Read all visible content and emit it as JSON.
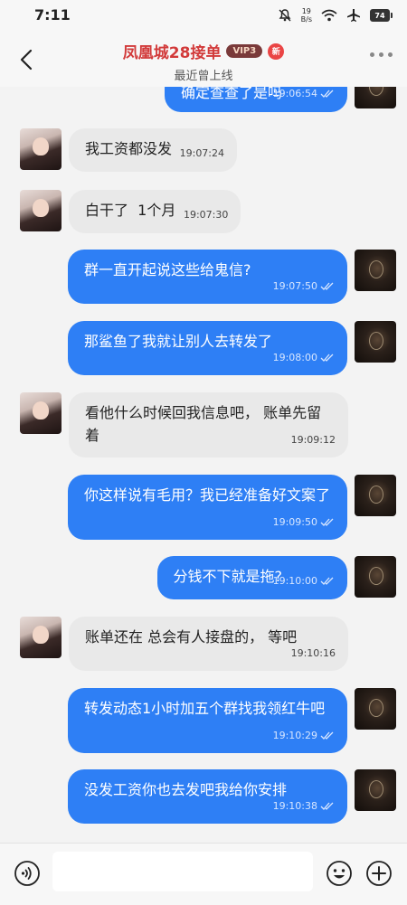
{
  "status_bar": {
    "time": "7:11",
    "net_speed_value": "19",
    "net_speed_unit": "B/s",
    "battery": "74"
  },
  "header": {
    "title": "凤凰城28接单",
    "vip_badge": "VIP3",
    "new_badge": "新",
    "subtitle": "最近曾上线"
  },
  "messages": [
    {
      "side": "out",
      "text": "确定查查了是吗",
      "time": "19:06:54"
    },
    {
      "side": "in",
      "text": "我工资都没发",
      "time": "19:07:24"
    },
    {
      "side": "in",
      "text": "白干了  1个月",
      "time": "19:07:30"
    },
    {
      "side": "out",
      "text": "群一直开起说这些给鬼信?",
      "time": "19:07:50"
    },
    {
      "side": "out",
      "text": "那鲨鱼了我就让别人去转发了",
      "time": "19:08:00"
    },
    {
      "side": "in",
      "text": "看他什么时候回我信息吧，  账单先留着",
      "time": "19:09:12"
    },
    {
      "side": "out",
      "text": "你这样说有毛用？我已经准备好文案了",
      "time": "19:09:50"
    },
    {
      "side": "out",
      "text": "分钱不下就是拖?",
      "time": "19:10:00"
    },
    {
      "side": "in",
      "text": "账单还在 总会有人接盘的，  等吧",
      "time": "19:10:16"
    },
    {
      "side": "out",
      "text": "转发动态1小时加五个群找我领红牛吧",
      "time": "19:10:29"
    },
    {
      "side": "out",
      "text": "没发工资你也去发吧我给你安排",
      "time": "19:10:38"
    }
  ],
  "input": {
    "placeholder": ""
  },
  "icons": {
    "back": "chevron-left-icon",
    "more": "more-dots-icon",
    "read": "double-check-icon",
    "voice": "voice-icon",
    "emoji": "emoji-icon",
    "plus": "plus-icon"
  },
  "colors": {
    "title": "#d23a3a",
    "outgoing_bubble": "#2e7ff5",
    "incoming_bubble": "#e9e9e9",
    "background": "#f3f3f3"
  }
}
